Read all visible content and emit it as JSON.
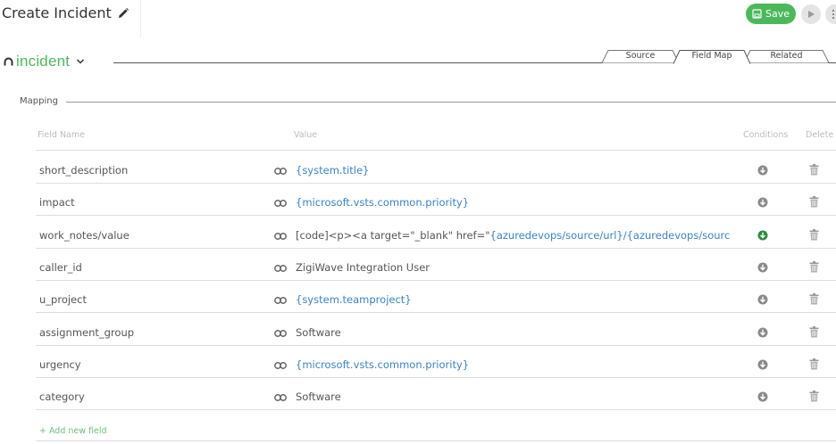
{
  "header": {
    "title": "Create Incident",
    "save_label": "Save"
  },
  "entity": {
    "label": "incident"
  },
  "tabs": [
    {
      "label": "Source",
      "active": false
    },
    {
      "label": "Field Map",
      "active": true
    },
    {
      "label": "Related",
      "active": false
    }
  ],
  "mapping": {
    "section_label": "Mapping",
    "columns": {
      "field_name": "Field Name",
      "value": "Value",
      "conditions": "Conditions",
      "delete": "Delete"
    },
    "rows": [
      {
        "field": "short_description",
        "value_prefix": "",
        "value_var": "{system.title}",
        "condition_active": false
      },
      {
        "field": "impact",
        "value_prefix": "",
        "value_var": "{microsoft.vsts.common.priority}",
        "condition_active": false
      },
      {
        "field": "work_notes/value",
        "value_prefix": "[code]<p><a target=\"_blank\" href=\"",
        "value_var": "{azuredevops/source/url}/{azuredevops/sourc",
        "condition_active": true
      },
      {
        "field": "caller_id",
        "value_prefix": "ZigiWave Integration User",
        "value_var": "",
        "condition_active": false
      },
      {
        "field": "u_project",
        "value_prefix": "",
        "value_var": "{system.teamproject}",
        "condition_active": false
      },
      {
        "field": "assignment_group",
        "value_prefix": "Software",
        "value_var": "",
        "condition_active": false
      },
      {
        "field": "urgency",
        "value_prefix": "",
        "value_var": "{microsoft.vsts.common.priority}",
        "condition_active": false
      },
      {
        "field": "category",
        "value_prefix": "Software",
        "value_var": "",
        "condition_active": false
      }
    ],
    "add_label": "+ Add new field"
  },
  "colors": {
    "accent_green": "#4cb85c",
    "variable_blue": "#3b83c4",
    "condition_active": "#2e8b3e",
    "condition_idle": "#8a8a8a"
  }
}
